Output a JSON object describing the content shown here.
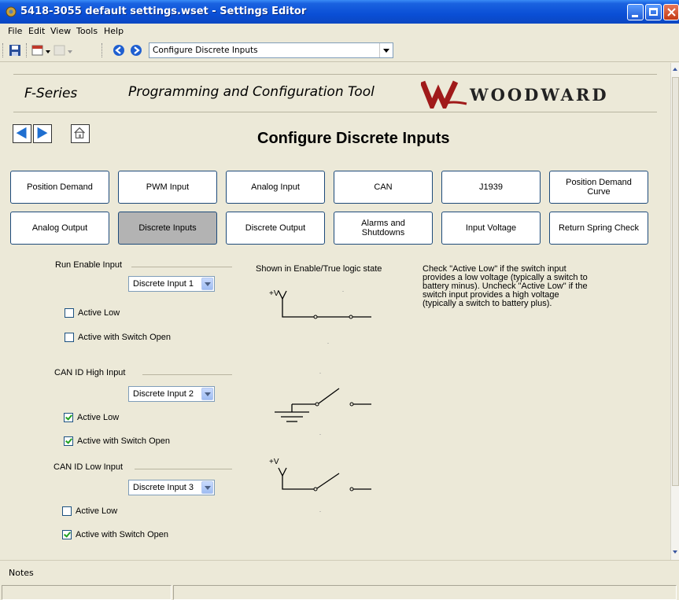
{
  "window": {
    "title": "5418-3055 default settings.wset - Settings Editor"
  },
  "menu": {
    "items": [
      "File",
      "Edit",
      "View",
      "Tools",
      "Help"
    ]
  },
  "toolbar": {
    "page_select": "Configure Discrete Inputs"
  },
  "header": {
    "product": "F-Series",
    "tool_title": "Programming and Configuration Tool",
    "brand": "WOODWARD"
  },
  "page": {
    "title": "Configure Discrete Inputs"
  },
  "tiles": [
    {
      "label": "Position Demand",
      "selected": false
    },
    {
      "label": "PWM Input",
      "selected": false
    },
    {
      "label": "Analog Input",
      "selected": false
    },
    {
      "label": "CAN",
      "selected": false
    },
    {
      "label": "J1939",
      "selected": false
    },
    {
      "label": "Position Demand Curve",
      "selected": false
    },
    {
      "label": "Analog Output",
      "selected": false
    },
    {
      "label": "Discrete Inputs",
      "selected": true
    },
    {
      "label": "Discrete Output",
      "selected": false
    },
    {
      "label": "Alarms and Shutdowns",
      "selected": false
    },
    {
      "label": "Input Voltage",
      "selected": false
    },
    {
      "label": "Return Spring Check",
      "selected": false
    }
  ],
  "groups": [
    {
      "title": "Run Enable Input",
      "input": "Discrete Input 1",
      "active_low": false,
      "active_switch_open": false
    },
    {
      "title": "CAN ID High Input",
      "input": "Discrete Input 2",
      "active_low": true,
      "active_switch_open": true
    },
    {
      "title": "CAN ID Low Input",
      "input": "Discrete Input 3",
      "active_low": false,
      "active_switch_open": true
    }
  ],
  "labels": {
    "active_low": "Active Low",
    "active_switch_open": "Active with Switch Open"
  },
  "diagram": {
    "caption": "Shown in Enable/True logic state",
    "voltage": "+V"
  },
  "help_text": [
    "Check \"Active Low\" if the switch input",
    "provides a low voltage (typically a switch to",
    "battery minus). Uncheck \"Active Low\" if the",
    "switch input provides a high voltage",
    "(typically a switch to battery plus)."
  ],
  "notes": {
    "label": "Notes"
  },
  "colors": {
    "titlebar": "#0a4fd6",
    "woodward_logo": "#a01a1a",
    "tile_border": "#1d4a7a",
    "nav_arrow": "#1f6fd0"
  }
}
